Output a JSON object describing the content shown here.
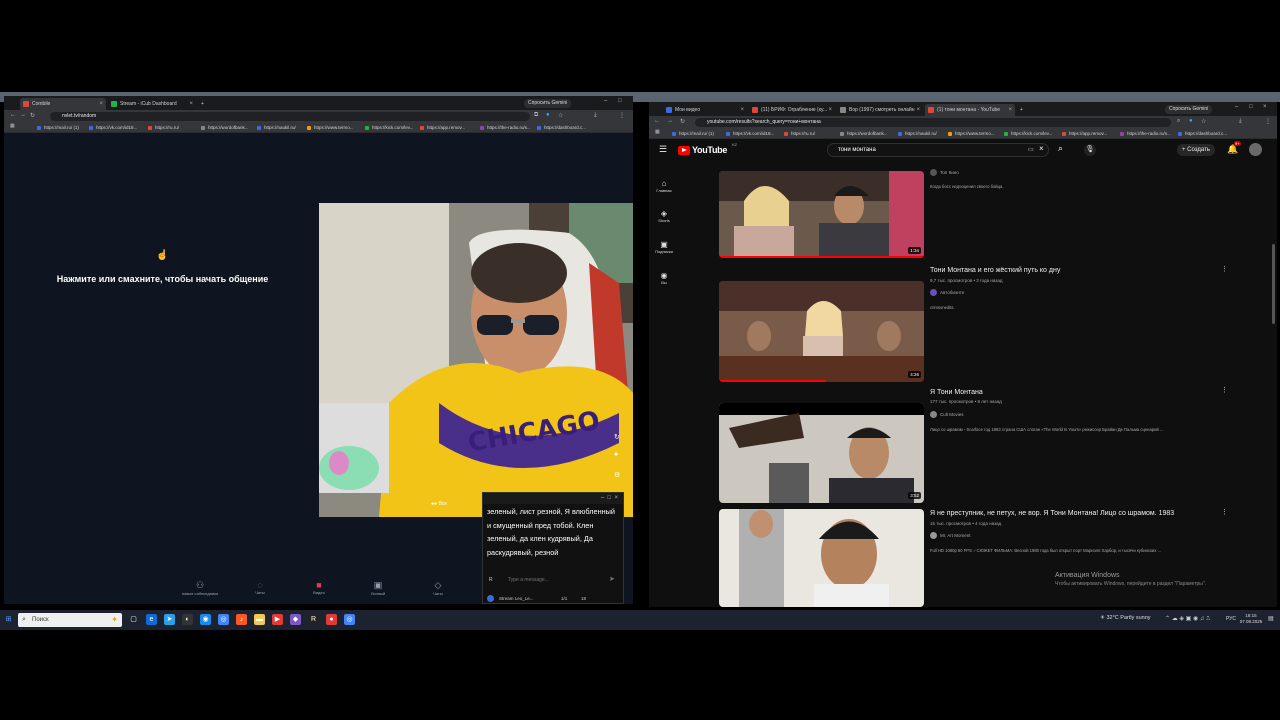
{
  "left_browser": {
    "tabs": [
      {
        "label": "Combile",
        "color": "#e2463b"
      },
      {
        "label": "Stream - iCub Dashboard",
        "color": "#22b14c"
      }
    ],
    "gemini_label": "Спросить Gemini",
    "url": "nvlet.tv/random",
    "bookmarks": [
      "https://mail.ru/ (1)",
      "https://vk.com/id18...",
      "https://ru.ru/",
      "https://wordofbank...",
      "https://naukil.ru/",
      "https://www.termo...",
      "https://kick.com/lev...",
      "https://app.remov...",
      "https://the-radio.ru/s...",
      "https://dashboard.c..."
    ]
  },
  "chatpage": {
    "prompt": "Нажмите или смахните, чтобы начать общение",
    "hand_icon": "hand-pointer",
    "bottom_nav": [
      {
        "label": "новые собеседники",
        "icon": "users-icon"
      },
      {
        "label": "Чаты",
        "icon": "chat-icon"
      },
      {
        "label": "Видео",
        "icon": "video-icon"
      },
      {
        "label": "Личный",
        "icon": "profile-icon"
      },
      {
        "label": "Чаты",
        "icon": "message-icon"
      }
    ],
    "video_overlay_label": "Все"
  },
  "chat_popup": {
    "message": "зеленый, лист резной, Я влюбленный и смущенный пред тобой. Клен зеленый, да клен кудрявый, Да раскудрявый, резной",
    "input_placeholder": "Type a message...",
    "footer_name": "Stream Leo_Le...",
    "footer_stats": "1/1",
    "footer_count": "18"
  },
  "right_browser": {
    "tabs": [
      {
        "label": "Мои видео",
        "color": "#3d6ae0"
      },
      {
        "label": "(11) БРИФ: Ограбление (ку...",
        "color": "#e2463b"
      },
      {
        "label": "Вор (1997) смотреть онлайн",
        "color": "#888888"
      },
      {
        "label": "(1) тони монтана - YouTube",
        "color": "#e2463b"
      }
    ],
    "gemini_label": "Спросить Gemini",
    "url": "youtube.com/results?search_query=тони+монтана",
    "bookmarks": [
      "https://mail.ru/ (1)",
      "https://vk.com/id18...",
      "https://ru.ru/",
      "https://wordofbank...",
      "https://naukil.ru/",
      "https://www.termo...",
      "https://kick.com/lev...",
      "https://app.remov...",
      "https://the-radio.ru/s...",
      "https://dashboard.c..."
    ]
  },
  "youtube": {
    "logo": "YouTube",
    "logo_sup": "KZ",
    "search_query": "тони монтана",
    "create_label": "Создать",
    "notif_count": "9+",
    "sidebar": [
      {
        "label": "Главная",
        "icon": "home-icon"
      },
      {
        "label": "Shorts",
        "icon": "shorts-icon"
      },
      {
        "label": "Подписки",
        "icon": "subscriptions-icon"
      },
      {
        "label": "Вы",
        "icon": "you-icon"
      }
    ],
    "results": [
      {
        "title": "",
        "views": "",
        "channel": "Топ Кино",
        "desc": "Когда босс недооценил своего бойца.",
        "duration": "1:34"
      },
      {
        "title": "Тони Монтана и его жёсткий путь ко дну",
        "views": "9,7 тыс. просмотров • 3 года назад",
        "channel": "Автобиэнте",
        "desc": "crimsonedits.",
        "duration": "4:26"
      },
      {
        "title": "Я Тони Монтана",
        "views": "177 тыс. просмотров • 8 лет назад",
        "channel": "Cult Movies",
        "desc": "Лицо со шрамом - Scarface год 1983 страна США слоган «The World Is Yours» режиссер Брайан Де Пальма сценарий ...",
        "duration": "3:52"
      },
      {
        "title": "Я не преступник, не петух, не вор. Я Тони Монтана! Лицо со шрамом. 1983",
        "views": "15 тыс. просмотров • 4 года назад",
        "channel": "Mr. Art Moment",
        "desc": "Full HD 1080p 60 FPS ✓СЮЖЕТ ФИЛЬМА: Весной 1980 года был открыт порт Мариэля Харбор, и тысячи кубинских ...",
        "duration": ""
      }
    ]
  },
  "watermark": {
    "line1": "Активация Windows",
    "line2": "Чтобы активировать Windows, перейдите в раздел \"Параметры\"."
  },
  "taskbar": {
    "search_placeholder": "Поиск",
    "weather": "32°C Partly sunny",
    "lang": "РУС",
    "time": "18:15",
    "date": "07.08.2025"
  },
  "colors": {
    "youtube_red": "#ff0000",
    "chat_bg": "#0e1420",
    "accent_green": "#22b14c"
  }
}
